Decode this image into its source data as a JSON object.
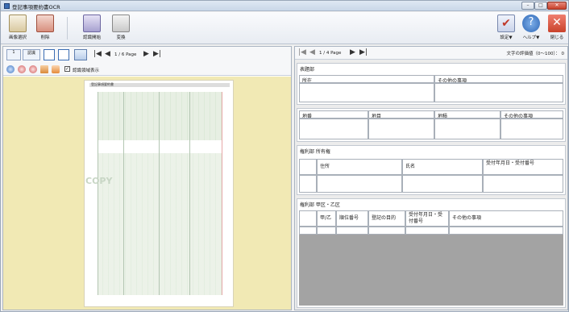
{
  "window": {
    "title": "登記事項要約書OCR",
    "controls": {
      "minimize": "–",
      "maximize": "□",
      "close": "✕"
    }
  },
  "toolbar": {
    "buttons": [
      {
        "id": "image-select",
        "label": "画像選択",
        "icon": "image-icon"
      },
      {
        "id": "delete",
        "label": "削除",
        "icon": "delete-icon"
      },
      {
        "id": "recognize",
        "label": "認識開始",
        "icon": "recognize-icon"
      },
      {
        "id": "convert",
        "label": "変換",
        "icon": "convert-icon"
      },
      {
        "id": "settings",
        "label": "設定▼",
        "icon": "checkmark-icon"
      },
      {
        "id": "help",
        "label": "ヘルプ▼",
        "icon": "help-icon"
      },
      {
        "id": "close",
        "label": "閉じる",
        "icon": "close-icon"
      }
    ]
  },
  "left_toolbar": {
    "page_info": "1 / 6 Page",
    "mini_buttons": [
      "1",
      "認識"
    ],
    "checkbox_label": "認識領域表示"
  },
  "document": {
    "header_text": "登記事項要約書",
    "watermark": "COPY"
  },
  "right_toolbar": {
    "page_info": "1 / 4 Page",
    "score_label": "文字の評価値（0～100）：",
    "score_value": "0"
  },
  "sections": {
    "hyodai": {
      "title": "表題部",
      "headers": [
        "所在",
        "その他の事項"
      ]
    },
    "land": {
      "headers": [
        "地番",
        "地目",
        "地積",
        "その他の事項"
      ]
    },
    "owner": {
      "title": "権利部 所有権",
      "headers": [
        "住所",
        "氏名",
        "受付年月日・受付番号"
      ]
    },
    "rights": {
      "title": "権利部 甲区・乙区",
      "headers": [
        "甲/乙",
        "順位番号",
        "登記の目的",
        "受付年月日・受付番号",
        "その他の事項"
      ]
    }
  },
  "colors": {
    "viewer_bg": "#f1e9b4",
    "close_red": "#c9422b",
    "accent_blue": "#3b6db3"
  }
}
